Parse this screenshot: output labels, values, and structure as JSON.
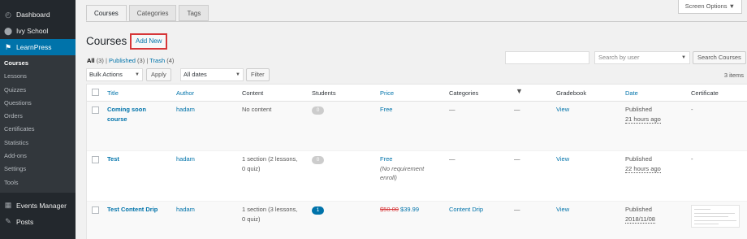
{
  "sidebar": {
    "items": [
      {
        "label": "Dashboard",
        "icon": "dashboard-icon"
      },
      {
        "label": "Ivy School",
        "icon": "ivy-school-icon"
      },
      {
        "label": "LearnPress",
        "icon": "learnpress-icon"
      }
    ],
    "submenu": [
      "Courses",
      "Lessons",
      "Quizzes",
      "Questions",
      "Orders",
      "Certificates",
      "Statistics",
      "Add-ons",
      "Settings",
      "Tools"
    ],
    "bottom_items": [
      {
        "label": "Events Manager",
        "icon": "calendar-icon"
      },
      {
        "label": "Posts",
        "icon": "pin-icon"
      }
    ]
  },
  "tabs": [
    "Courses",
    "Categories",
    "Tags"
  ],
  "screen_options": "Screen Options ▼",
  "page": {
    "title": "Courses",
    "add_new": "Add New"
  },
  "filters": {
    "all": "All",
    "all_count": "(3)",
    "published": "Published",
    "published_count": "(3)",
    "trash": "Trash",
    "trash_count": "(4)",
    "sep": "|"
  },
  "toolbar": {
    "bulk_actions": "Bulk Actions",
    "apply": "Apply",
    "dates": "All dates",
    "filter": "Filter",
    "search_by_user": "Search by user",
    "search_courses": "Search Courses",
    "items_count": "3 items",
    "arrow": "▼"
  },
  "columns": {
    "title": "Title",
    "author": "Author",
    "content": "Content",
    "students": "Students",
    "price": "Price",
    "categories": "Categories",
    "comments_icon": "comment-icon",
    "gradebook": "Gradebook",
    "date": "Date",
    "certificate": "Certificate"
  },
  "rows": [
    {
      "title_line1": "Coming soon",
      "title_line2": "course",
      "author": "hadam",
      "content": "No content",
      "content2": "",
      "students": "0",
      "price": "Free",
      "price_note1": "",
      "price_note2": "",
      "categories": "—",
      "comments": "—",
      "gradebook": "View",
      "status": "Published",
      "date": "21 hours ago",
      "certificate": "-"
    },
    {
      "title_line1": "Test",
      "title_line2": "",
      "author": "hadam",
      "content": "1 section (2 lessons,",
      "content2": "0 quiz)",
      "students": "0",
      "price": "Free",
      "price_note1": "(No requirement",
      "price_note2": "enroll)",
      "categories": "—",
      "comments": "—",
      "gradebook": "View",
      "status": "Published",
      "date": "22 hours ago",
      "certificate": "-"
    },
    {
      "title_line1": "Test Content Drip",
      "title_line2": "",
      "author": "hadam",
      "content": "1 section (3 lessons,",
      "content2": "0 quiz)",
      "students": "1",
      "price_old": "$50.00",
      "price": "$39.99",
      "categories": "Content Drip",
      "comments": "—",
      "gradebook": "View",
      "status": "Published",
      "date": "2018/11/08"
    }
  ],
  "colors": {
    "accent": "#0073aa",
    "sidebar": "#23282d",
    "highlight": "#d63638"
  }
}
